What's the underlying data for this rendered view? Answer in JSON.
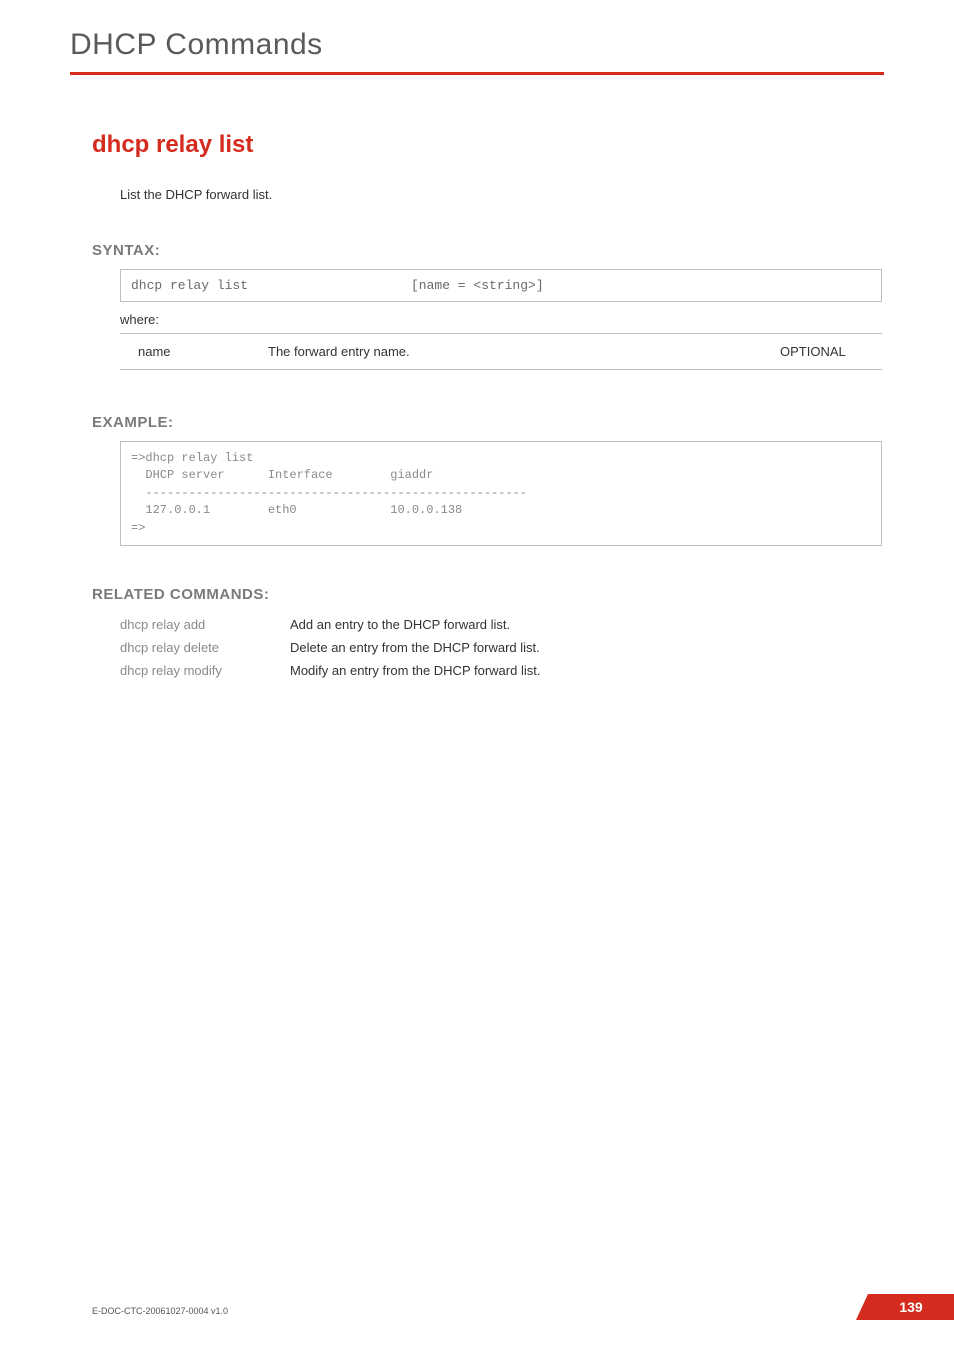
{
  "header": {
    "chapter_title": "DHCP Commands"
  },
  "topic": {
    "title": "dhcp relay list",
    "description": "List the DHCP forward list."
  },
  "syntax": {
    "heading": "SYNTAX:",
    "command": "dhcp relay list",
    "args": "[name = <string>]",
    "where_label": "where:",
    "params": [
      {
        "name": "name",
        "desc": "The forward entry name.",
        "req": "OPTIONAL"
      }
    ]
  },
  "example": {
    "heading": "EXAMPLE:",
    "text": "=>dhcp relay list\n  DHCP server      Interface        giaddr\n  -----------------------------------------------------\n  127.0.0.1        eth0             10.0.0.138\n=>"
  },
  "related": {
    "heading": "RELATED COMMANDS:",
    "items": [
      {
        "name": "dhcp relay add",
        "desc": "Add an entry to the DHCP forward list."
      },
      {
        "name": "dhcp relay delete",
        "desc": "Delete an entry from the DHCP forward list."
      },
      {
        "name": "dhcp relay modify",
        "desc": "Modify an entry from the DHCP forward list."
      }
    ]
  },
  "footer": {
    "doc_id": "E-DOC-CTC-20061027-0004 v1.0",
    "page_number": "139"
  }
}
